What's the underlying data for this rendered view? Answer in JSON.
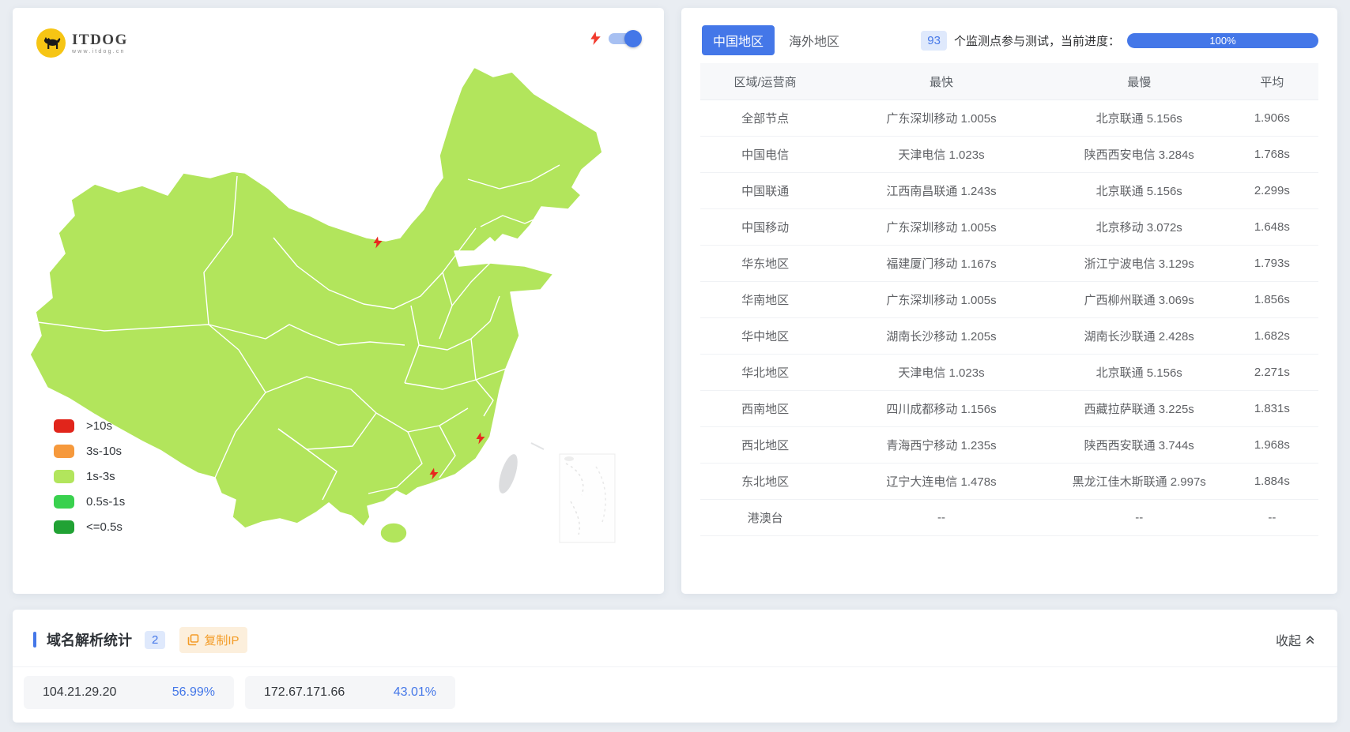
{
  "map_panel": {
    "logo": {
      "brand": "ITDOG",
      "site": "www.itdog.cn"
    },
    "legend": [
      {
        "label": ">10s",
        "color": "#e1251b"
      },
      {
        "label": "3s-10s",
        "color": "#f6993c"
      },
      {
        "label": "1s-3s",
        "color": "#b2e55c"
      },
      {
        "label": "0.5s-1s",
        "color": "#39d14e"
      },
      {
        "label": "<=0.5s",
        "color": "#21a234"
      }
    ],
    "map_fill": "#b2e55c",
    "toggle_state": "on"
  },
  "results_panel": {
    "tabs": [
      {
        "label": "中国地区",
        "active": true
      },
      {
        "label": "海外地区",
        "active": false
      }
    ],
    "monitor_count": "93",
    "progress_caption": "个监测点参与测试，当前进度：",
    "progress_value": "100%",
    "table": {
      "headers": [
        "区域/运营商",
        "最快",
        "最慢",
        "平均"
      ],
      "rows": [
        {
          "region": "全部节点",
          "fastest": "广东深圳移动 1.005s",
          "slowest": "北京联通 5.156s",
          "avg": "1.906s"
        },
        {
          "region": "中国电信",
          "fastest": "天津电信 1.023s",
          "slowest": "陕西西安电信 3.284s",
          "avg": "1.768s"
        },
        {
          "region": "中国联通",
          "fastest": "江西南昌联通 1.243s",
          "slowest": "北京联通 5.156s",
          "avg": "2.299s"
        },
        {
          "region": "中国移动",
          "fastest": "广东深圳移动 1.005s",
          "slowest": "北京移动 3.072s",
          "avg": "1.648s"
        },
        {
          "region": "华东地区",
          "fastest": "福建厦门移动 1.167s",
          "slowest": "浙江宁波电信 3.129s",
          "avg": "1.793s"
        },
        {
          "region": "华南地区",
          "fastest": "广东深圳移动 1.005s",
          "slowest": "广西柳州联通 3.069s",
          "avg": "1.856s"
        },
        {
          "region": "华中地区",
          "fastest": "湖南长沙移动 1.205s",
          "slowest": "湖南长沙联通 2.428s",
          "avg": "1.682s"
        },
        {
          "region": "华北地区",
          "fastest": "天津电信 1.023s",
          "slowest": "北京联通 5.156s",
          "avg": "2.271s"
        },
        {
          "region": "西南地区",
          "fastest": "四川成都移动 1.156s",
          "slowest": "西藏拉萨联通 3.225s",
          "avg": "1.831s"
        },
        {
          "region": "西北地区",
          "fastest": "青海西宁移动 1.235s",
          "slowest": "陕西西安联通 3.744s",
          "avg": "1.968s"
        },
        {
          "region": "东北地区",
          "fastest": "辽宁大连电信 1.478s",
          "slowest": "黑龙江佳木斯联通 2.997s",
          "avg": "1.884s"
        },
        {
          "region": "港澳台",
          "fastest": "--",
          "slowest": "--",
          "avg": "--"
        }
      ]
    }
  },
  "dns_panel": {
    "title": "域名解析统计",
    "count_badge": "2",
    "copy_ip_label": "复制IP",
    "collapse_label": "收起",
    "ips": [
      {
        "ip": "104.21.29.20",
        "percent": "56.99%"
      },
      {
        "ip": "172.67.171.66",
        "percent": "43.01%"
      }
    ]
  },
  "colors": {
    "accent_blue": "#4477e8",
    "accent_orange": "#f39c27",
    "marker_red": "#e8281e"
  }
}
